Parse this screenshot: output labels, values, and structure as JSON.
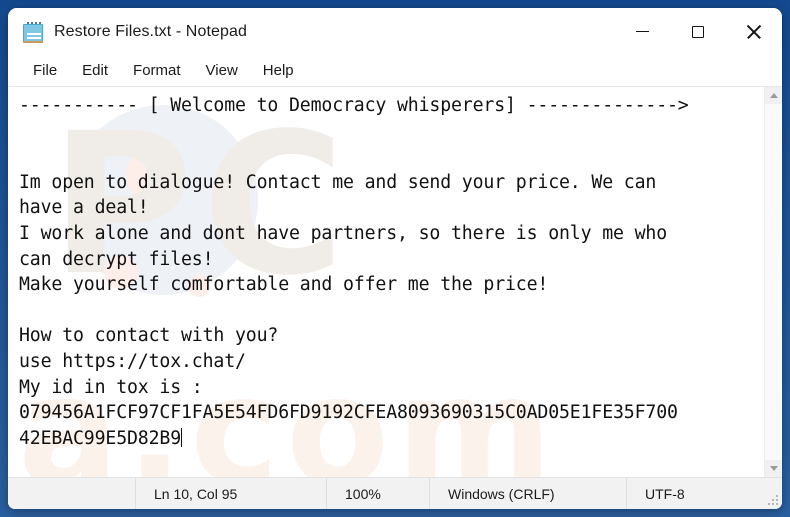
{
  "window": {
    "title": "Restore Files.txt - Notepad",
    "icon": "notepad-icon",
    "controls": {
      "minimize": "minimize-icon",
      "maximize": "maximize-icon",
      "close": "close-icon"
    }
  },
  "menubar": {
    "items": [
      {
        "label": "File"
      },
      {
        "label": "Edit"
      },
      {
        "label": "Format"
      },
      {
        "label": "View"
      },
      {
        "label": "Help"
      }
    ]
  },
  "document": {
    "lines": [
      "----------- [ Welcome to Democracy whisperers] -------------->",
      "",
      "",
      "Im open to dialogue! Contact me and send your price. We can",
      "have a deal!",
      "I work alone and dont have partners, so there is only me who",
      "can decrypt files!",
      "Make yourself comfortable and offer me the price!",
      "",
      "How to contact with you?",
      "use https://tox.chat/",
      "My id in tox is :",
      "079456A1FCF97CF1FA5E54FD6FD9192CFEA8093690315C0AD05E1FE35F700",
      "42EBAC99E5D82B9"
    ],
    "caret_line_index": 13
  },
  "watermark": {
    "top_text": "PC",
    "bottom_text": "a.com"
  },
  "scrollbar": {
    "up_arrow": "scroll-up-icon",
    "down_arrow": "scroll-down-icon"
  },
  "statusbar": {
    "cursor_position": "Ln 10, Col 95",
    "zoom": "100%",
    "line_ending": "Windows (CRLF)",
    "encoding": "UTF-8"
  },
  "colors": {
    "desktop": "#1f5498",
    "window_bg": "#ffffff",
    "statusbar_bg": "#f2f2f2",
    "text": "#111111",
    "icon_blue": "#7ec8e3"
  }
}
